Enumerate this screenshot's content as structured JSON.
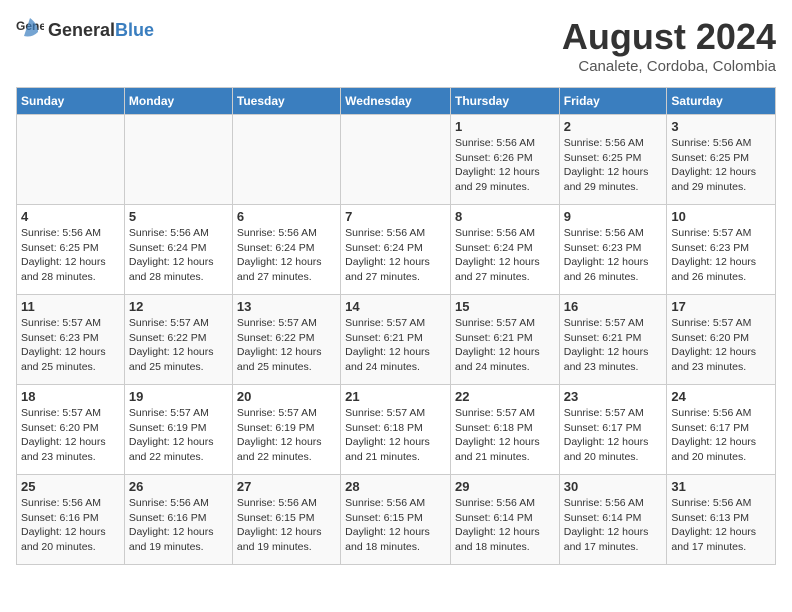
{
  "header": {
    "logo_general": "General",
    "logo_blue": "Blue",
    "month_year": "August 2024",
    "location": "Canalete, Cordoba, Colombia"
  },
  "days_of_week": [
    "Sunday",
    "Monday",
    "Tuesday",
    "Wednesday",
    "Thursday",
    "Friday",
    "Saturday"
  ],
  "weeks": [
    [
      {
        "day": "",
        "info": ""
      },
      {
        "day": "",
        "info": ""
      },
      {
        "day": "",
        "info": ""
      },
      {
        "day": "",
        "info": ""
      },
      {
        "day": "1",
        "info": "Sunrise: 5:56 AM\nSunset: 6:26 PM\nDaylight: 12 hours\nand 29 minutes."
      },
      {
        "day": "2",
        "info": "Sunrise: 5:56 AM\nSunset: 6:25 PM\nDaylight: 12 hours\nand 29 minutes."
      },
      {
        "day": "3",
        "info": "Sunrise: 5:56 AM\nSunset: 6:25 PM\nDaylight: 12 hours\nand 29 minutes."
      }
    ],
    [
      {
        "day": "4",
        "info": "Sunrise: 5:56 AM\nSunset: 6:25 PM\nDaylight: 12 hours\nand 28 minutes."
      },
      {
        "day": "5",
        "info": "Sunrise: 5:56 AM\nSunset: 6:24 PM\nDaylight: 12 hours\nand 28 minutes."
      },
      {
        "day": "6",
        "info": "Sunrise: 5:56 AM\nSunset: 6:24 PM\nDaylight: 12 hours\nand 27 minutes."
      },
      {
        "day": "7",
        "info": "Sunrise: 5:56 AM\nSunset: 6:24 PM\nDaylight: 12 hours\nand 27 minutes."
      },
      {
        "day": "8",
        "info": "Sunrise: 5:56 AM\nSunset: 6:24 PM\nDaylight: 12 hours\nand 27 minutes."
      },
      {
        "day": "9",
        "info": "Sunrise: 5:56 AM\nSunset: 6:23 PM\nDaylight: 12 hours\nand 26 minutes."
      },
      {
        "day": "10",
        "info": "Sunrise: 5:57 AM\nSunset: 6:23 PM\nDaylight: 12 hours\nand 26 minutes."
      }
    ],
    [
      {
        "day": "11",
        "info": "Sunrise: 5:57 AM\nSunset: 6:23 PM\nDaylight: 12 hours\nand 25 minutes."
      },
      {
        "day": "12",
        "info": "Sunrise: 5:57 AM\nSunset: 6:22 PM\nDaylight: 12 hours\nand 25 minutes."
      },
      {
        "day": "13",
        "info": "Sunrise: 5:57 AM\nSunset: 6:22 PM\nDaylight: 12 hours\nand 25 minutes."
      },
      {
        "day": "14",
        "info": "Sunrise: 5:57 AM\nSunset: 6:21 PM\nDaylight: 12 hours\nand 24 minutes."
      },
      {
        "day": "15",
        "info": "Sunrise: 5:57 AM\nSunset: 6:21 PM\nDaylight: 12 hours\nand 24 minutes."
      },
      {
        "day": "16",
        "info": "Sunrise: 5:57 AM\nSunset: 6:21 PM\nDaylight: 12 hours\nand 23 minutes."
      },
      {
        "day": "17",
        "info": "Sunrise: 5:57 AM\nSunset: 6:20 PM\nDaylight: 12 hours\nand 23 minutes."
      }
    ],
    [
      {
        "day": "18",
        "info": "Sunrise: 5:57 AM\nSunset: 6:20 PM\nDaylight: 12 hours\nand 23 minutes."
      },
      {
        "day": "19",
        "info": "Sunrise: 5:57 AM\nSunset: 6:19 PM\nDaylight: 12 hours\nand 22 minutes."
      },
      {
        "day": "20",
        "info": "Sunrise: 5:57 AM\nSunset: 6:19 PM\nDaylight: 12 hours\nand 22 minutes."
      },
      {
        "day": "21",
        "info": "Sunrise: 5:57 AM\nSunset: 6:18 PM\nDaylight: 12 hours\nand 21 minutes."
      },
      {
        "day": "22",
        "info": "Sunrise: 5:57 AM\nSunset: 6:18 PM\nDaylight: 12 hours\nand 21 minutes."
      },
      {
        "day": "23",
        "info": "Sunrise: 5:57 AM\nSunset: 6:17 PM\nDaylight: 12 hours\nand 20 minutes."
      },
      {
        "day": "24",
        "info": "Sunrise: 5:56 AM\nSunset: 6:17 PM\nDaylight: 12 hours\nand 20 minutes."
      }
    ],
    [
      {
        "day": "25",
        "info": "Sunrise: 5:56 AM\nSunset: 6:16 PM\nDaylight: 12 hours\nand 20 minutes."
      },
      {
        "day": "26",
        "info": "Sunrise: 5:56 AM\nSunset: 6:16 PM\nDaylight: 12 hours\nand 19 minutes."
      },
      {
        "day": "27",
        "info": "Sunrise: 5:56 AM\nSunset: 6:15 PM\nDaylight: 12 hours\nand 19 minutes."
      },
      {
        "day": "28",
        "info": "Sunrise: 5:56 AM\nSunset: 6:15 PM\nDaylight: 12 hours\nand 18 minutes."
      },
      {
        "day": "29",
        "info": "Sunrise: 5:56 AM\nSunset: 6:14 PM\nDaylight: 12 hours\nand 18 minutes."
      },
      {
        "day": "30",
        "info": "Sunrise: 5:56 AM\nSunset: 6:14 PM\nDaylight: 12 hours\nand 17 minutes."
      },
      {
        "day": "31",
        "info": "Sunrise: 5:56 AM\nSunset: 6:13 PM\nDaylight: 12 hours\nand 17 minutes."
      }
    ]
  ]
}
